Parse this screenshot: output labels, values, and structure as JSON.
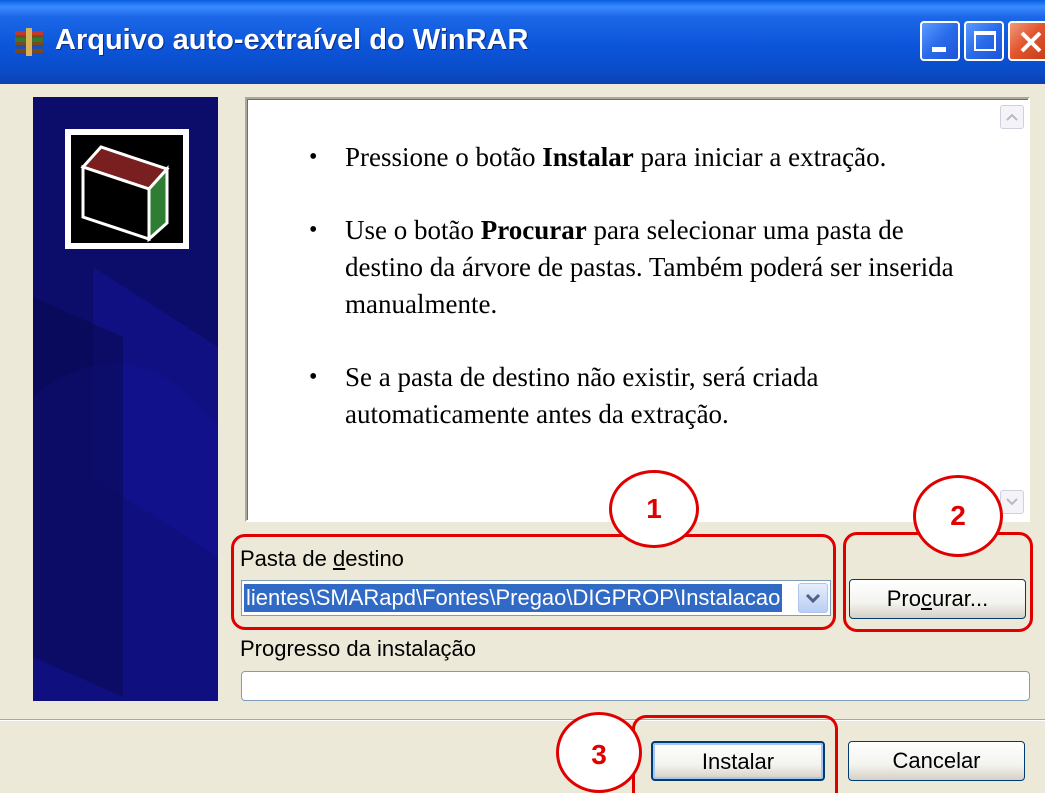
{
  "window": {
    "title": "Arquivo auto-extraível do WinRAR",
    "icon": "winrar-icon"
  },
  "titlebar_buttons": {
    "minimize": "minimize-icon",
    "maximize": "maximize-icon",
    "close": "close-icon"
  },
  "instructions": [
    {
      "before": "Pressione o botão ",
      "bold": "Instalar",
      "after": " para iniciar a extração."
    },
    {
      "before": "Use o botão ",
      "bold": "Procurar",
      "after": " para selecionar uma pasta de destino da árvore de pastas. Também poderá ser inserida manualmente."
    },
    {
      "before": "Se a pasta de destino não existir, será criada automaticamente antes da extração.",
      "bold": "",
      "after": ""
    }
  ],
  "destination": {
    "label_pre": "Pasta de ",
    "label_accel": "d",
    "label_post": "estino",
    "value": "lientes\\SMARapd\\Fontes\\Pregao\\DIGPROP\\Instalacao"
  },
  "browse_button": {
    "pre": "Pro",
    "accel": "c",
    "post": "urar..."
  },
  "progress": {
    "label": "Progresso da instalação",
    "fraction": 0
  },
  "install_button": "Instalar",
  "cancel_button": "Cancelar",
  "annotations": [
    "1",
    "2",
    "3"
  ],
  "colors": {
    "annotation": "#E00000",
    "titlebar": "#0C55DA",
    "selection": "#316AC5",
    "banner": "#0C0C6A"
  }
}
